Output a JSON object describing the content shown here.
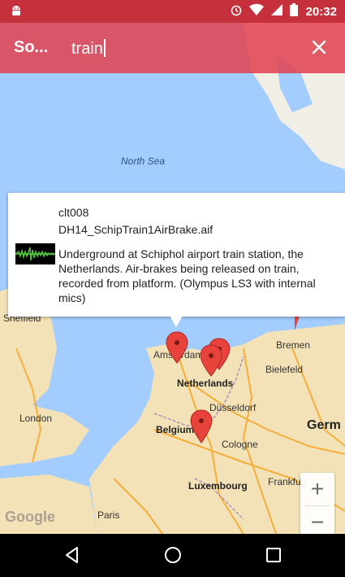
{
  "status_bar": {
    "time": "20:32",
    "icons": [
      "android-icon",
      "alarm-icon",
      "wifi-icon",
      "signal-icon",
      "battery-icon"
    ]
  },
  "app_bar": {
    "title": "So...",
    "search_value": "train",
    "close_icon": "close-icon"
  },
  "map": {
    "labels": {
      "north_sea": "North Sea",
      "amsterdam": "Amsterdam",
      "netherlands": "Netherlands",
      "bremen": "Bremen",
      "bielefeld": "Bielefeld",
      "dusseldorf": "Düsseldorf",
      "belgium": "Belgium",
      "cologne": "Cologne",
      "germany": "Germ",
      "sheffield": "Sheffield",
      "london": "London",
      "frankfurt": "Frankfurt",
      "luxembourg": "Luxembourg",
      "paris": "Paris"
    },
    "marker_color": "#e8433b",
    "zoom_in": "+",
    "zoom_out": "−",
    "attribution": "Google"
  },
  "info_window": {
    "sound_id": "clt008",
    "file_name": "DH14_SchipTrain1AirBrake.aif",
    "description": "Underground at Schiphol airport train station, the Netherlands. Air-brakes being released on train, recorded from platform. (Olympus LS3 with internal mics)"
  },
  "nav_bar": {
    "icons": [
      "back-icon",
      "home-icon",
      "recents-icon"
    ]
  }
}
